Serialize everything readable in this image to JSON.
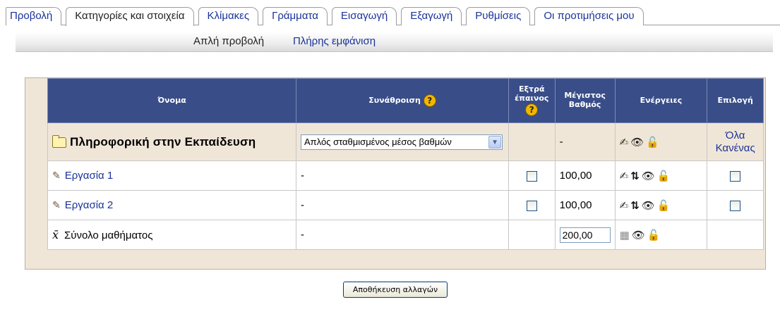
{
  "tabs": [
    {
      "label": "Προβολή",
      "active": false
    },
    {
      "label": "Κατηγορίες και στοιχεία",
      "active": true
    },
    {
      "label": "Κλίμακες",
      "active": false
    },
    {
      "label": "Γράμματα",
      "active": false
    },
    {
      "label": "Εισαγωγή",
      "active": false
    },
    {
      "label": "Εξαγωγή",
      "active": false
    },
    {
      "label": "Ρυθμίσεις",
      "active": false
    },
    {
      "label": "Οι προτιμήσεις μου",
      "active": false
    }
  ],
  "subtabs": {
    "current": "Απλή προβολή",
    "link": "Πλήρης εμφάνιση"
  },
  "table": {
    "headers": {
      "name": "Όνομα",
      "aggregation": "Συνάθροιση",
      "extra_credit_1": "Εξτρά",
      "extra_credit_2": "έπαινος",
      "max_grade_1": "Μέγιστος",
      "max_grade_2": "Βαθμός",
      "actions": "Ενέργειες",
      "select": "Επιλογή"
    },
    "help_icon": "help-icon",
    "category": {
      "name": "Πληροφορική στην Εκπαίδευση",
      "aggregation_value": "Απλός σταθμισμένος μέσος βαθμών",
      "max_grade": "-",
      "select_all": "Όλα",
      "select_none": "Κανένας"
    },
    "items": [
      {
        "name": "Εργασία 1",
        "aggregation": "-",
        "max_grade": "100,00"
      },
      {
        "name": "Εργασία 2",
        "aggregation": "-",
        "max_grade": "100,00"
      }
    ],
    "total": {
      "name": "Σύνολο μαθήματος",
      "aggregation": "-",
      "max_grade_value": "200,00"
    }
  },
  "save_button": "Αποθήκευση αλλαγών",
  "colors": {
    "header_bg": "#394d88",
    "category_bg": "#f0e6d8",
    "link": "#1a3399"
  }
}
